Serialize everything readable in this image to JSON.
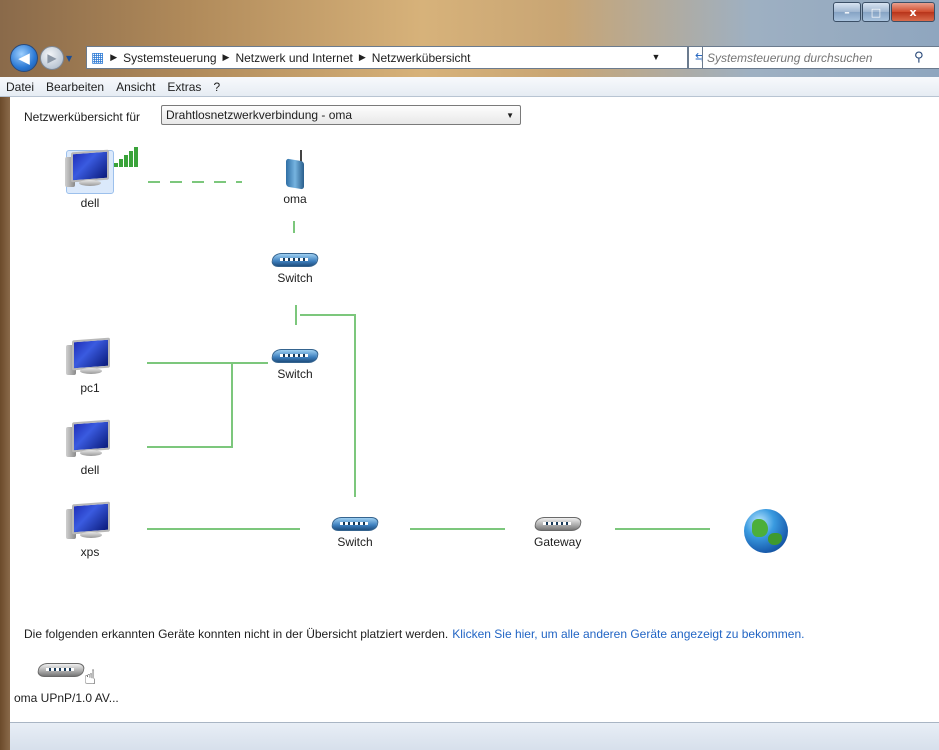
{
  "window": {
    "controls": {
      "minimize": "–",
      "maximize": "□",
      "close": "x"
    }
  },
  "address": {
    "crumbs": [
      "Systemsteuerung",
      "Netzwerk und Internet",
      "Netzwerkübersicht"
    ],
    "search_placeholder": "Systemsteuerung durchsuchen"
  },
  "menu": [
    "Datei",
    "Bearbeiten",
    "Ansicht",
    "Extras",
    "?"
  ],
  "overview": {
    "label": "Netzwerkübersicht für",
    "selected": "Drahtlosnetzwerkverbindung - oma"
  },
  "nodes": {
    "dell_wireless": "dell",
    "router": "oma",
    "switch1": "Switch",
    "switch2": "Switch",
    "pc1": "pc1",
    "dell2": "dell",
    "xps": "xps",
    "switch3": "Switch",
    "gateway": "Gateway"
  },
  "unplaced": {
    "message": "Die folgenden erkannten Geräte konnten nicht in der Übersicht platziert werden.",
    "link": "Klicken Sie hier, um alle anderen Geräte angezeigt zu bekommen.",
    "device": "oma UPnP/1.0 AV..."
  },
  "colors": {
    "link_line": "#7cc77c",
    "link_text": "#2265c4"
  }
}
